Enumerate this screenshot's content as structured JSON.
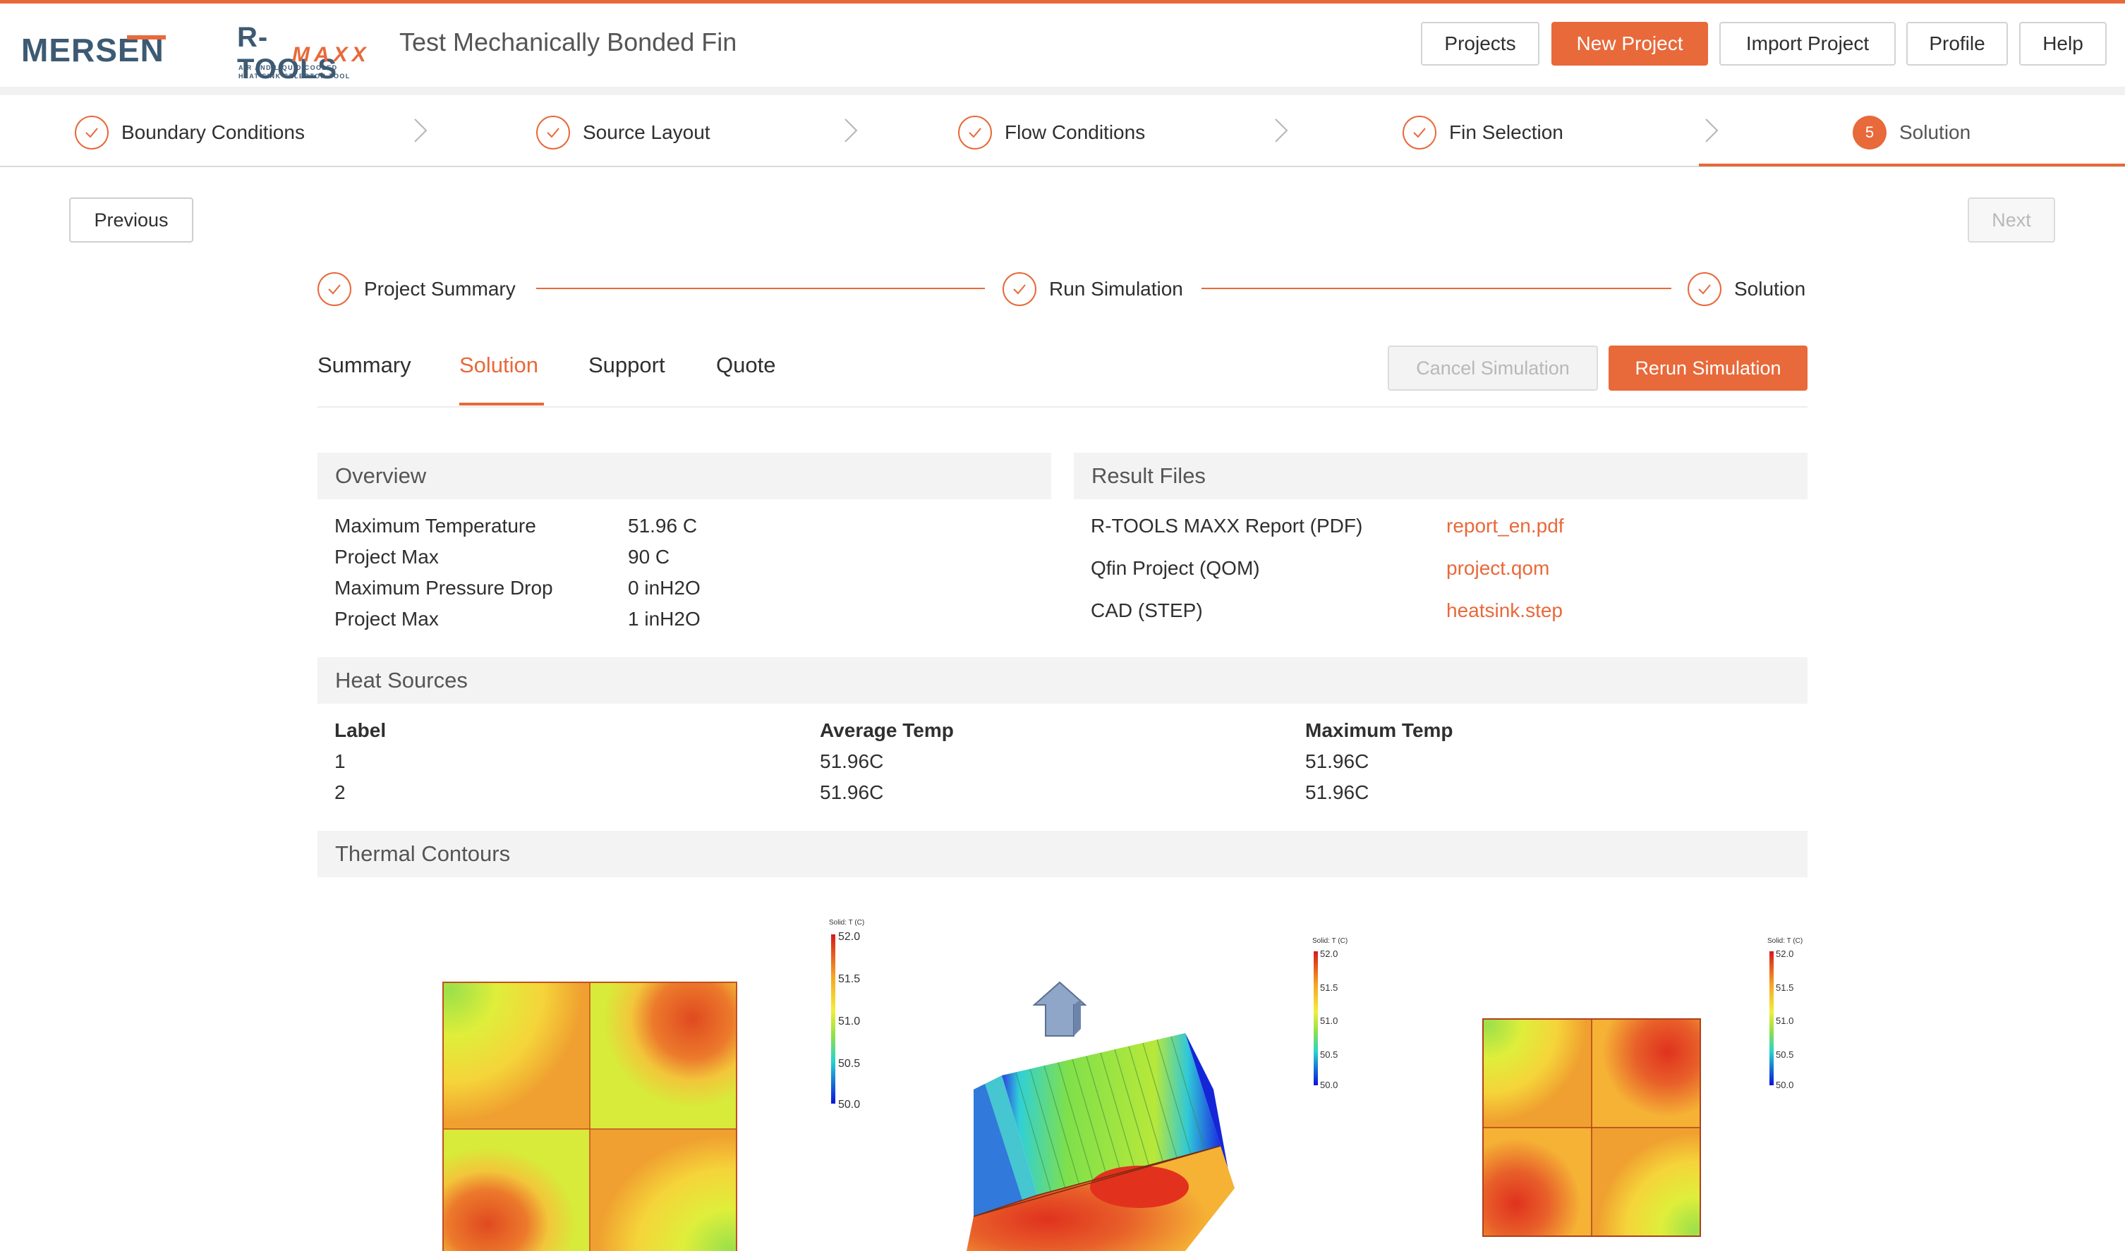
{
  "header": {
    "brand": "MERSEN",
    "product": "R-TOOLS",
    "product_sub": "MAXX",
    "product_tag_1": "AIR AND LIQUID COOLED",
    "product_tag_2": "HEAT SINK SELECTOR TOOL",
    "project_title": "Test Mechanically Bonded Fin",
    "buttons": [
      "Projects",
      "New Project",
      "Import Project",
      "Profile",
      "Help"
    ]
  },
  "steps": [
    {
      "label": "Boundary Conditions",
      "state": "done"
    },
    {
      "label": "Source Layout",
      "state": "done"
    },
    {
      "label": "Flow Conditions",
      "state": "done"
    },
    {
      "label": "Fin Selection",
      "state": "done"
    },
    {
      "label": "Solution",
      "state": "current",
      "number": "5"
    }
  ],
  "nav": {
    "previous": "Previous",
    "next": "Next"
  },
  "substeps": [
    "Project Summary",
    "Run Simulation",
    "Solution"
  ],
  "tabs": {
    "items": [
      "Summary",
      "Solution",
      "Support",
      "Quote"
    ],
    "active": "Solution",
    "cancel": "Cancel Simulation",
    "rerun": "Rerun Simulation"
  },
  "overview": {
    "title": "Overview",
    "rows": [
      {
        "label": "Maximum Temperature",
        "value": "51.96 C"
      },
      {
        "label": "Project Max",
        "value": "90 C"
      },
      {
        "label": "Maximum Pressure Drop",
        "value": "0 inH2O"
      },
      {
        "label": "Project Max",
        "value": "1 inH2O"
      }
    ]
  },
  "result_files": {
    "title": "Result Files",
    "rows": [
      {
        "label": "R-TOOLS MAXX Report (PDF)",
        "file": "report_en.pdf"
      },
      {
        "label": "Qfin Project (QOM)",
        "file": "project.qom"
      },
      {
        "label": "CAD (STEP)",
        "file": "heatsink.step"
      }
    ]
  },
  "heat_sources": {
    "title": "Heat Sources",
    "columns": [
      "Label",
      "Average Temp",
      "Maximum Temp"
    ],
    "rows": [
      [
        "1",
        "51.96C",
        "51.96C"
      ],
      [
        "2",
        "51.96C",
        "51.96C"
      ]
    ]
  },
  "thermal": {
    "title": "Thermal Contours",
    "colorbar_title_1": "Solid: T (C)",
    "colorbar_title_2": "Solid: T (C)",
    "colorbar_title_3": "Solid: T (C)",
    "ticks": [
      "52.0",
      "51.5",
      "51.0",
      "50.5",
      "50.0"
    ]
  },
  "colors": {
    "accent": "#e8693a",
    "brand_blue": "#3d5a73"
  }
}
